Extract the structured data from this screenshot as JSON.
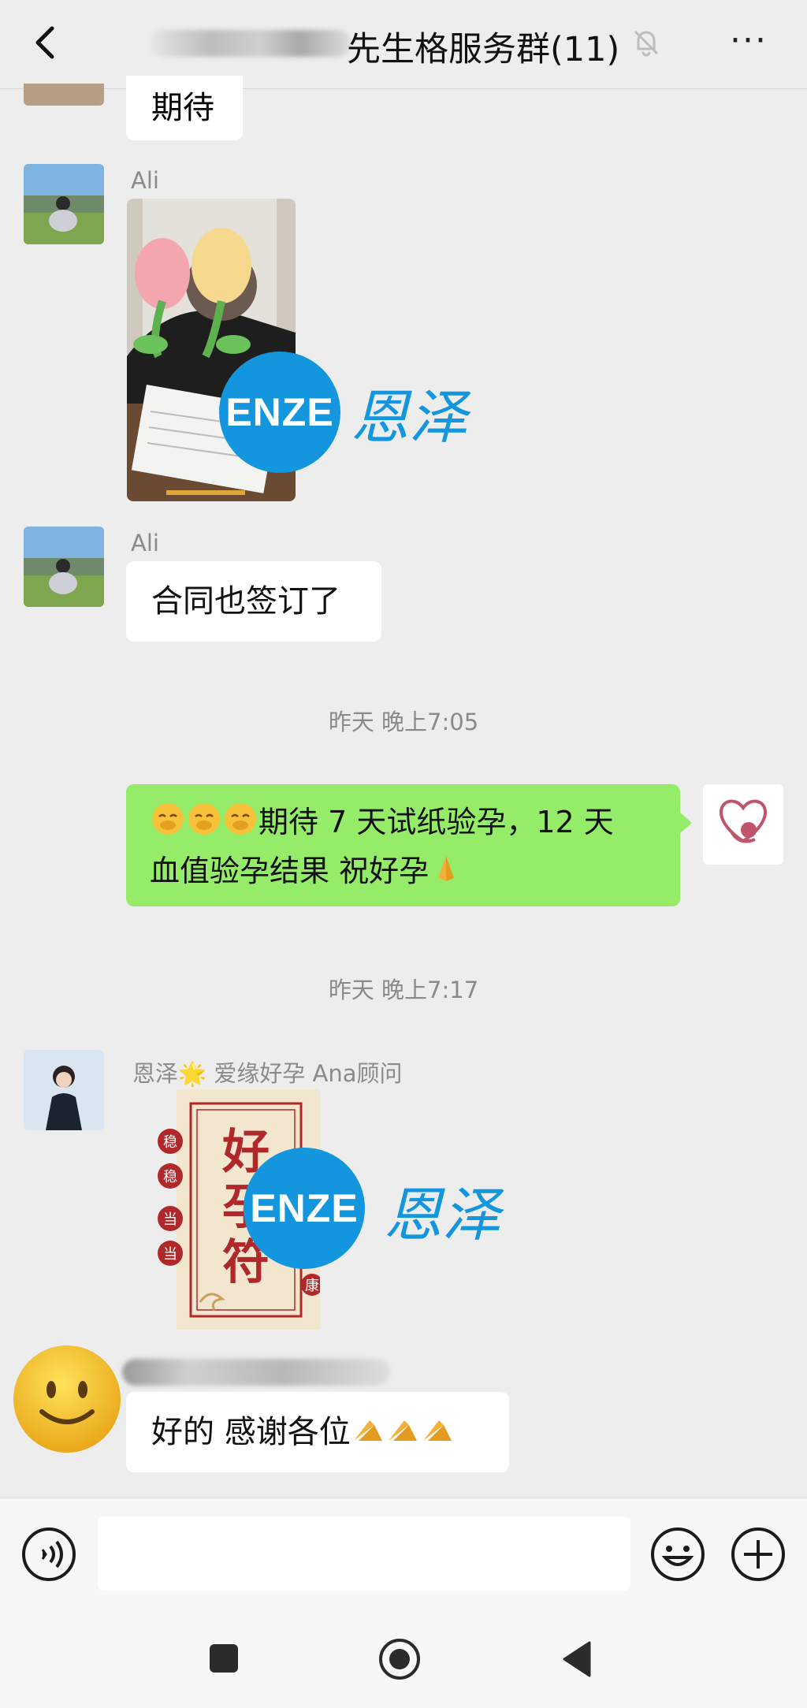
{
  "header": {
    "title": "先生格服务群(11)",
    "back_icon": "chevron-left-icon",
    "mute_icon": "bell-muted-icon",
    "more_label": "···"
  },
  "messages": {
    "m0": {
      "text": "期待"
    },
    "m1": {
      "sender": "Ali",
      "type": "image",
      "watermark_en": "ENZE",
      "watermark_cn": "恩泽"
    },
    "m2": {
      "sender": "Ali",
      "text": "合同也签订了"
    },
    "t1": "昨天 晚上7:05",
    "m3": {
      "text_line1": "期待 7 天试纸验孕，12 天",
      "text_line2": "血值验孕结果 祝好孕"
    },
    "t2": "昨天 晚上7:17",
    "m4": {
      "sender_prefix": "恩泽",
      "sender_suffix": "爱缘好孕 Ana顾问",
      "type": "image",
      "sticker_title": "好孕符",
      "side_chars": [
        "稳",
        "稳",
        "当",
        "当"
      ],
      "corner_char": "康",
      "watermark_en": "ENZE",
      "watermark_cn": "恩泽"
    },
    "m5": {
      "text": "好的 感谢各位"
    }
  },
  "input": {
    "voice_icon": "voice-icon",
    "emoji_icon": "smiley-icon",
    "plus_icon": "plus-icon"
  },
  "nav": {
    "recent_icon": "square-icon",
    "home_icon": "circle-icon",
    "back_icon": "triangle-back-icon"
  },
  "colors": {
    "my_bubble": "#95EC69",
    "brand_blue": "#1396DE",
    "background": "#EDEDED"
  }
}
